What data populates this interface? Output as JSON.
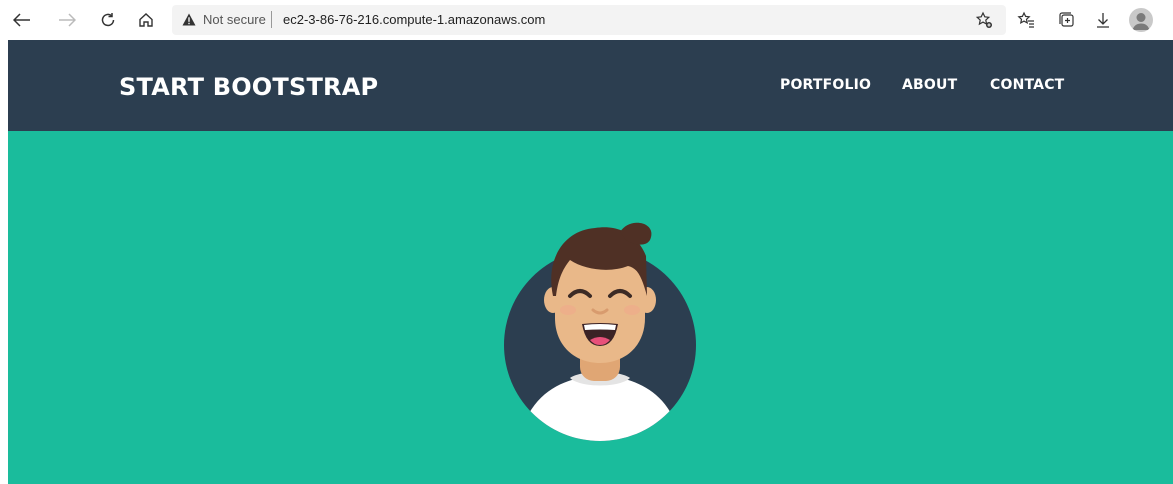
{
  "browser": {
    "security_label": "Not secure",
    "url": "ec2-3-86-76-216.compute-1.amazonaws.com",
    "icons": [
      "back-icon",
      "forward-icon",
      "refresh-icon",
      "home-icon",
      "warning-icon",
      "add-favorite-icon",
      "favorites-icon",
      "collections-icon",
      "downloads-icon",
      "profile-icon"
    ]
  },
  "site": {
    "brand": "START BOOTSTRAP",
    "nav": [
      {
        "label": "PORTFOLIO"
      },
      {
        "label": "ABOUT"
      },
      {
        "label": "CONTACT"
      }
    ],
    "colors": {
      "navbar": "#2c3e50",
      "masthead": "#1abc9c",
      "avatar_circle": "#2c3e50",
      "skin": "#e9b889",
      "hair": "#4f3025"
    }
  }
}
